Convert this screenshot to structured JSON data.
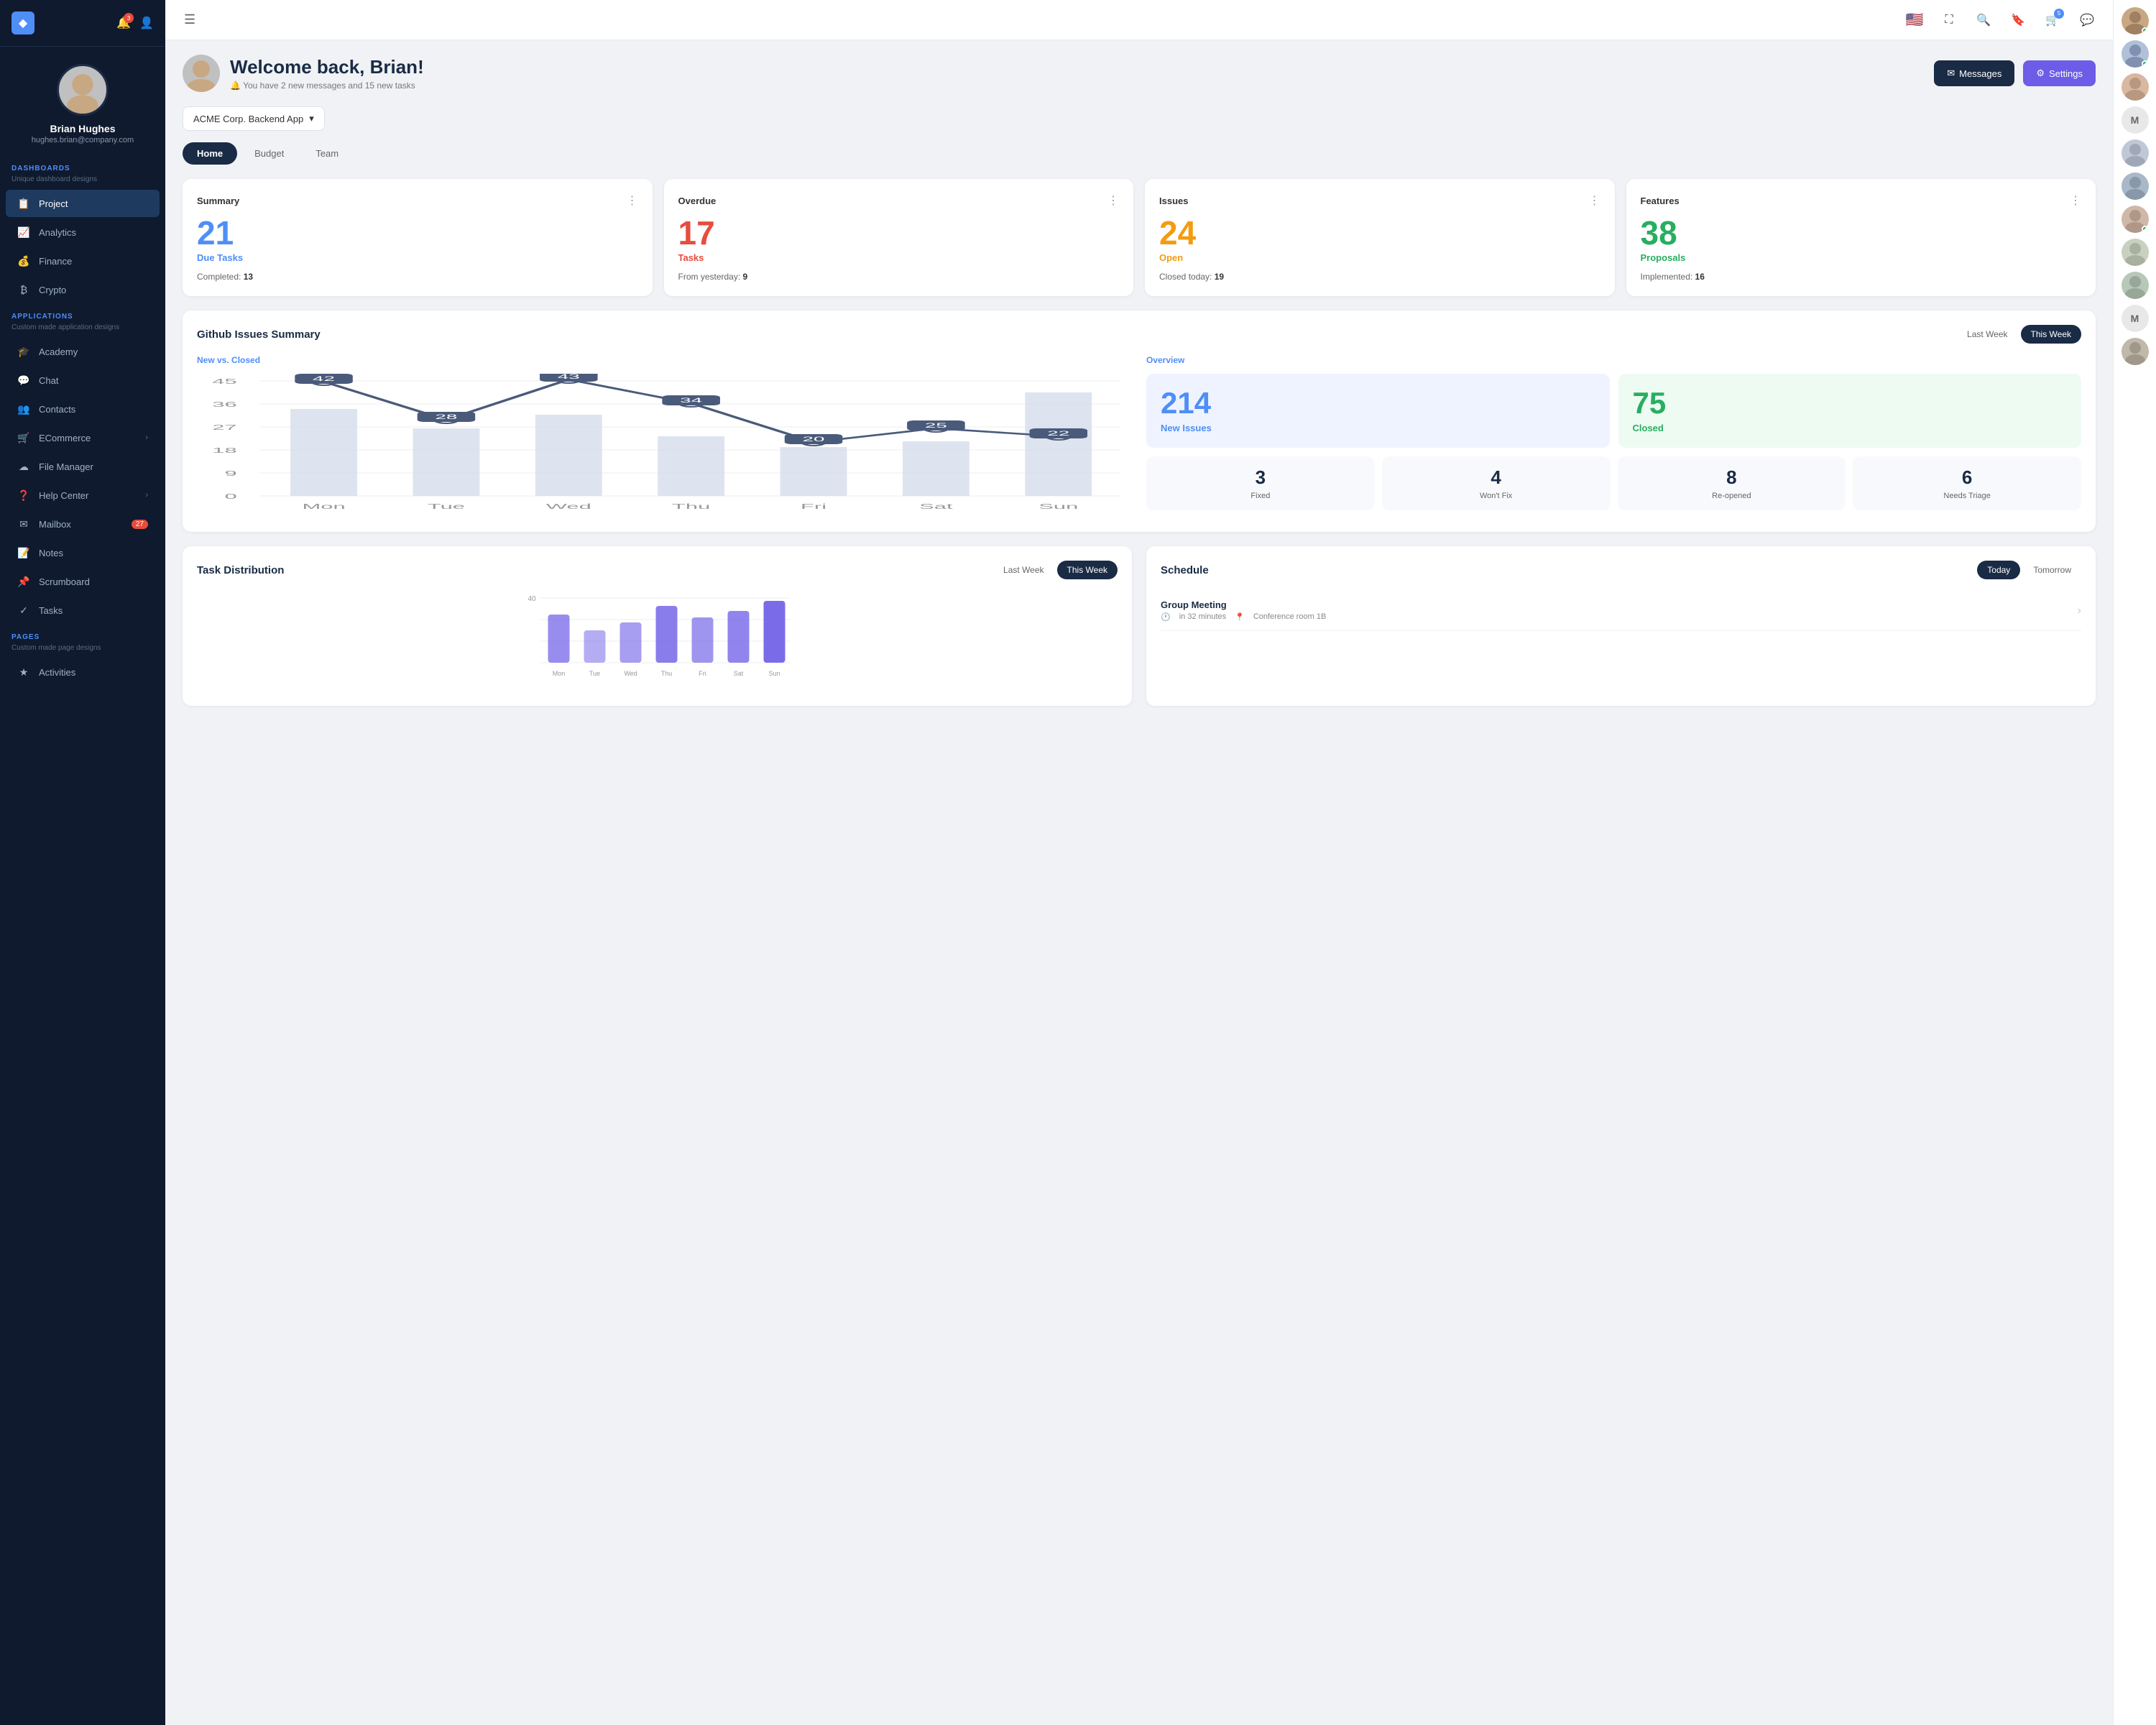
{
  "sidebar": {
    "logo": "◆",
    "notifications_count": "3",
    "user": {
      "name": "Brian Hughes",
      "email": "hughes.brian@company.com"
    },
    "dashboards_label": "DASHBOARDS",
    "dashboards_sub": "Unique dashboard designs",
    "nav_items_dashboards": [
      {
        "icon": "📋",
        "label": "Project",
        "active": true
      },
      {
        "icon": "📈",
        "label": "Analytics"
      },
      {
        "icon": "💰",
        "label": "Finance"
      },
      {
        "icon": "₿",
        "label": "Crypto"
      }
    ],
    "applications_label": "APPLICATIONS",
    "applications_sub": "Custom made application designs",
    "nav_items_apps": [
      {
        "icon": "🎓",
        "label": "Academy"
      },
      {
        "icon": "💬",
        "label": "Chat"
      },
      {
        "icon": "👥",
        "label": "Contacts"
      },
      {
        "icon": "🛒",
        "label": "ECommerce",
        "arrow": "›"
      },
      {
        "icon": "☁",
        "label": "File Manager"
      },
      {
        "icon": "❓",
        "label": "Help Center",
        "arrow": "›"
      },
      {
        "icon": "✉",
        "label": "Mailbox",
        "badge": "27"
      },
      {
        "icon": "📝",
        "label": "Notes"
      },
      {
        "icon": "📌",
        "label": "Scrumboard"
      },
      {
        "icon": "✓",
        "label": "Tasks"
      }
    ],
    "pages_label": "PAGES",
    "pages_sub": "Custom made page designs",
    "nav_items_pages": [
      {
        "icon": "★",
        "label": "Activities"
      }
    ]
  },
  "topbar": {
    "flag": "🇺🇸",
    "notifications_count": "5"
  },
  "header": {
    "greeting": "Welcome back, Brian!",
    "subtext": "You have 2 new messages and 15 new tasks",
    "messages_btn": "Messages",
    "settings_btn": "Settings"
  },
  "project_selector": {
    "label": "ACME Corp. Backend App"
  },
  "tabs": [
    "Home",
    "Budget",
    "Team"
  ],
  "active_tab": "Home",
  "cards": [
    {
      "title": "Summary",
      "number": "21",
      "number_color": "blue",
      "label": "Due Tasks",
      "label_color": "blue",
      "footer_key": "Completed:",
      "footer_val": "13"
    },
    {
      "title": "Overdue",
      "number": "17",
      "number_color": "red",
      "label": "Tasks",
      "label_color": "red",
      "footer_key": "From yesterday:",
      "footer_val": "9"
    },
    {
      "title": "Issues",
      "number": "24",
      "number_color": "orange",
      "label": "Open",
      "label_color": "orange",
      "footer_key": "Closed today:",
      "footer_val": "19"
    },
    {
      "title": "Features",
      "number": "38",
      "number_color": "green",
      "label": "Proposals",
      "label_color": "green",
      "footer_key": "Implemented:",
      "footer_val": "16"
    }
  ],
  "github": {
    "title": "Github Issues Summary",
    "toggle_last": "Last Week",
    "toggle_this": "This Week",
    "chart_label": "New vs. Closed",
    "chart_days": [
      "Mon",
      "Tue",
      "Wed",
      "Thu",
      "Fri",
      "Sat",
      "Sun"
    ],
    "chart_line_values": [
      42,
      28,
      43,
      34,
      20,
      25,
      22
    ],
    "chart_bar_values": [
      32,
      25,
      30,
      22,
      18,
      20,
      38
    ],
    "chart_y_labels": [
      "45",
      "36",
      "27",
      "18",
      "9",
      "0"
    ],
    "overview_label": "Overview",
    "new_issues": "214",
    "new_issues_label": "New Issues",
    "closed_issues": "75",
    "closed_label": "Closed",
    "stats": [
      {
        "num": "3",
        "label": "Fixed"
      },
      {
        "num": "4",
        "label": "Won't Fix"
      },
      {
        "num": "8",
        "label": "Re-opened"
      },
      {
        "num": "6",
        "label": "Needs Triage"
      }
    ]
  },
  "task_dist": {
    "title": "Task Distribution",
    "toggle_last": "Last Week",
    "toggle_this": "This Week",
    "bar_labels": [
      "",
      "",
      "",
      "",
      "",
      "",
      ""
    ],
    "y_max": "40",
    "bar_values": [
      30,
      20,
      25,
      35,
      28,
      32,
      38
    ]
  },
  "schedule": {
    "title": "Schedule",
    "toggle_today": "Today",
    "toggle_tomorrow": "Tomorrow",
    "items": [
      {
        "title": "Group Meeting",
        "time": "in 32 minutes",
        "location": "Conference room 1B"
      }
    ]
  },
  "right_panel": {
    "avatars": [
      {
        "type": "img",
        "color": "#c8a882",
        "letter": "👤",
        "online": true
      },
      {
        "type": "img",
        "color": "#b0c8e8",
        "letter": "👤",
        "online": true
      },
      {
        "type": "img",
        "color": "#d8b8a0",
        "letter": "👤",
        "online": false
      },
      {
        "type": "letter",
        "color": "#e8e8e8",
        "letter": "M",
        "text_color": "#666"
      },
      {
        "type": "img",
        "color": "#c0c8d8",
        "letter": "👤",
        "online": false
      },
      {
        "type": "img",
        "color": "#a8b8c8",
        "letter": "👤",
        "online": false
      },
      {
        "type": "img",
        "color": "#d0b8a8",
        "letter": "👤",
        "online": true
      },
      {
        "type": "img",
        "color": "#c8d0c0",
        "letter": "👤",
        "online": false
      },
      {
        "type": "img",
        "color": "#b8c8b8",
        "letter": "👤",
        "online": false
      },
      {
        "type": "letter",
        "color": "#e8e8e8",
        "letter": "M",
        "text_color": "#666"
      },
      {
        "type": "img",
        "color": "#c0b8a8",
        "letter": "👤",
        "online": false
      }
    ]
  }
}
